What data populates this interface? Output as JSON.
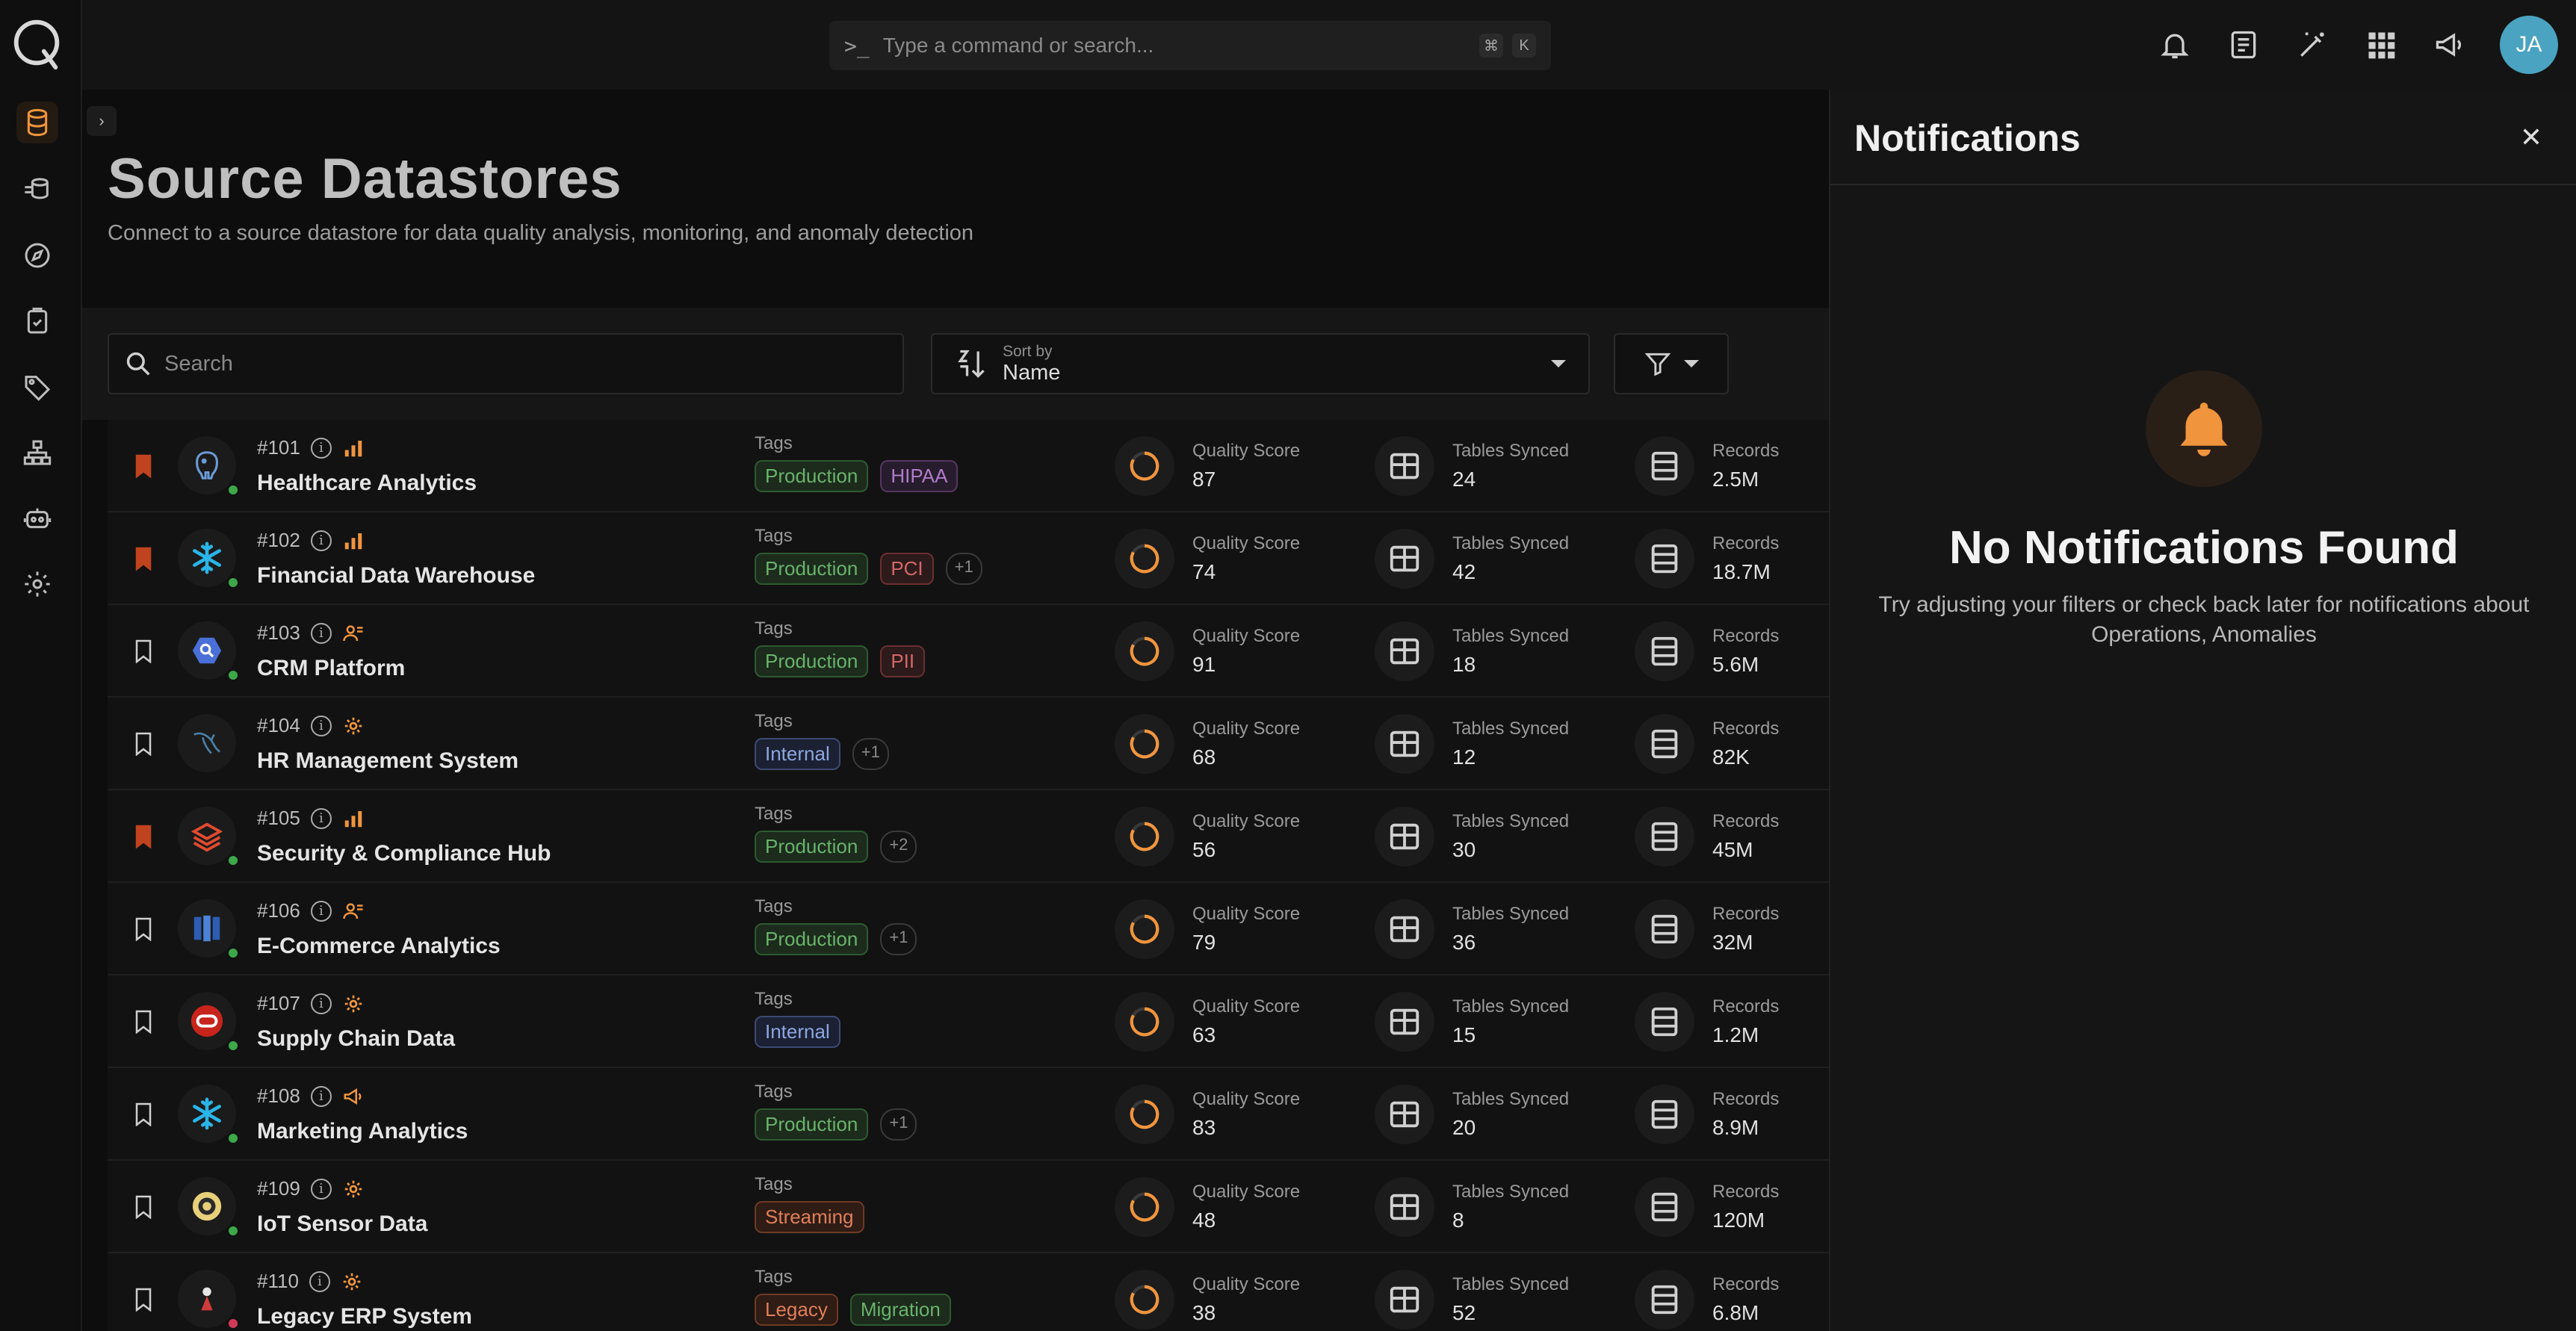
{
  "command_bar": {
    "placeholder": "Type a command or search...",
    "key1": "⌘",
    "key2": "K"
  },
  "user": {
    "initials": "JA"
  },
  "page": {
    "title": "Source Datastores",
    "subtitle": "Connect to a source datastore for data quality analysis, monitoring, and anomaly detection"
  },
  "toolbar": {
    "search_placeholder": "Search",
    "sort_label": "Sort by",
    "sort_value": "Name"
  },
  "labels": {
    "tags": "Tags",
    "quality": "Quality Score",
    "tables": "Tables Synced",
    "records": "Records"
  },
  "datastores": [
    {
      "id": "#101",
      "name": "Healthcare Analytics",
      "bookmarked": true,
      "type_icon": "bar-chart-icon",
      "logo": "postgres-icon",
      "tags": [
        {
          "t": "Production",
          "c": "green"
        },
        {
          "t": "HIPAA",
          "c": "purple"
        }
      ],
      "quality": "87",
      "tables": "24",
      "records": "2.5M",
      "status": "green"
    },
    {
      "id": "#102",
      "name": "Financial Data Warehouse",
      "bookmarked": true,
      "type_icon": "bar-chart-icon",
      "logo": "snowflake-icon",
      "tags": [
        {
          "t": "Production",
          "c": "green"
        },
        {
          "t": "PCI",
          "c": "red"
        },
        {
          "t": "+1",
          "c": "plus"
        }
      ],
      "quality": "74",
      "tables": "42",
      "records": "18.7M",
      "status": "green"
    },
    {
      "id": "#103",
      "name": "CRM Platform",
      "bookmarked": false,
      "type_icon": "users-icon",
      "logo": "bigquery-icon",
      "tags": [
        {
          "t": "Production",
          "c": "green"
        },
        {
          "t": "PII",
          "c": "red"
        }
      ],
      "quality": "91",
      "tables": "18",
      "records": "5.6M",
      "status": "green"
    },
    {
      "id": "#104",
      "name": "HR Management System",
      "bookmarked": false,
      "type_icon": "gear-icon",
      "logo": "mysql-icon",
      "tags": [
        {
          "t": "Internal",
          "c": "blue"
        },
        {
          "t": "+1",
          "c": "plus"
        }
      ],
      "quality": "68",
      "tables": "12",
      "records": "82K",
      "status": "none"
    },
    {
      "id": "#105",
      "name": "Security & Compliance Hub",
      "bookmarked": true,
      "type_icon": "bar-chart-icon",
      "logo": "databricks-icon",
      "tags": [
        {
          "t": "Production",
          "c": "green"
        },
        {
          "t": "+2",
          "c": "plus"
        }
      ],
      "quality": "56",
      "tables": "30",
      "records": "45M",
      "status": "green"
    },
    {
      "id": "#106",
      "name": "E-Commerce Analytics",
      "bookmarked": false,
      "type_icon": "users-icon",
      "logo": "redshift-icon",
      "tags": [
        {
          "t": "Production",
          "c": "green"
        },
        {
          "t": "+1",
          "c": "plus"
        }
      ],
      "quality": "79",
      "tables": "36",
      "records": "32M",
      "status": "green"
    },
    {
      "id": "#107",
      "name": "Supply Chain Data",
      "bookmarked": false,
      "type_icon": "gear-icon",
      "logo": "oracle-icon",
      "tags": [
        {
          "t": "Internal",
          "c": "blue"
        }
      ],
      "quality": "63",
      "tables": "15",
      "records": "1.2M",
      "status": "green"
    },
    {
      "id": "#108",
      "name": "Marketing Analytics",
      "bookmarked": false,
      "type_icon": "megaphone-icon",
      "logo": "snowflake-icon",
      "tags": [
        {
          "t": "Production",
          "c": "green"
        },
        {
          "t": "+1",
          "c": "plus"
        }
      ],
      "quality": "83",
      "tables": "20",
      "records": "8.9M",
      "status": "green"
    },
    {
      "id": "#109",
      "name": "IoT Sensor Data",
      "bookmarked": false,
      "type_icon": "gear-icon",
      "logo": "hive-icon",
      "tags": [
        {
          "t": "Streaming",
          "c": "orange"
        }
      ],
      "quality": "48",
      "tables": "8",
      "records": "120M",
      "status": "green"
    },
    {
      "id": "#110",
      "name": "Legacy ERP System",
      "bookmarked": false,
      "type_icon": "gear-icon",
      "logo": "db2-icon",
      "tags": [
        {
          "t": "Legacy",
          "c": "orange"
        },
        {
          "t": "Migration",
          "c": "green"
        }
      ],
      "quality": "38",
      "tables": "52",
      "records": "6.8M",
      "status": "red"
    }
  ],
  "notifications": {
    "title": "Notifications",
    "empty_title": "No Notifications Found",
    "empty_sub": "Try adjusting your filters or check back later for notifications about Operations, Anomalies"
  },
  "colors": {
    "accent": "#f0953d",
    "avatar": "#4aa3c0",
    "bookmark_active": "#c0431f"
  }
}
